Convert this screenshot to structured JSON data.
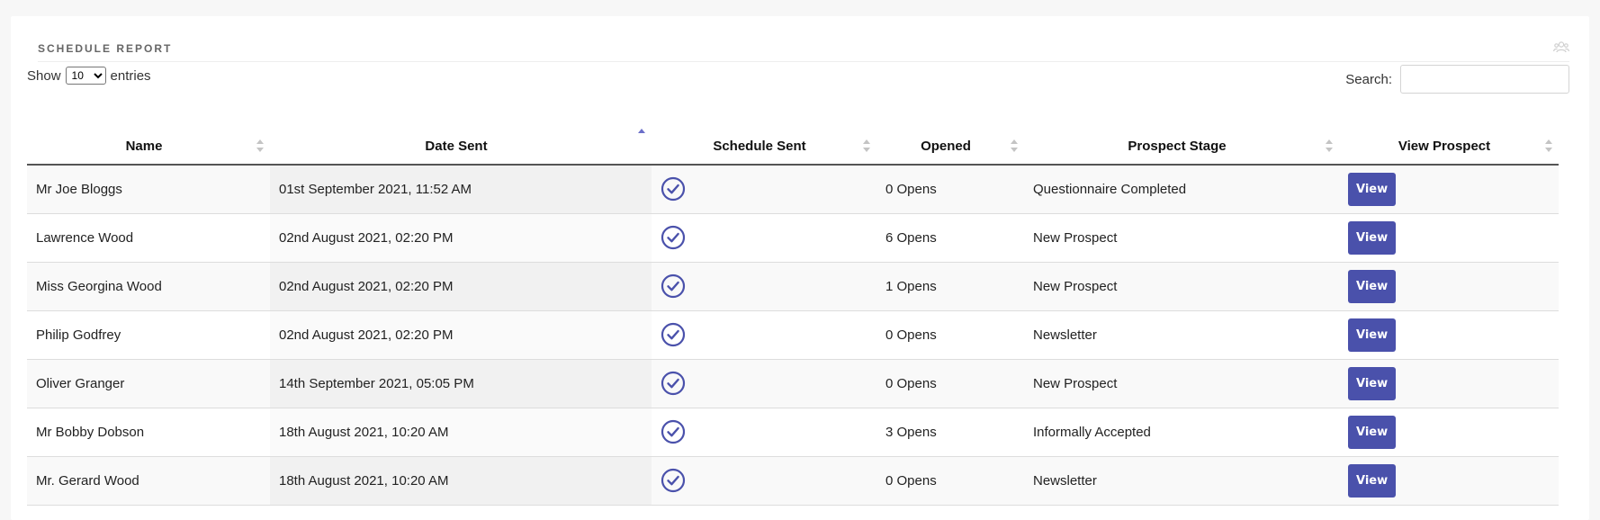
{
  "panel": {
    "title": "SCHEDULE REPORT",
    "header_icon": "users-icon"
  },
  "controls": {
    "show_label": "Show",
    "entries_label": "entries",
    "page_length": "10",
    "search_label": "Search:",
    "search_value": ""
  },
  "table": {
    "columns": [
      {
        "label": "Name",
        "sort": "none"
      },
      {
        "label": "Date Sent",
        "sort": "asc"
      },
      {
        "label": "Schedule Sent",
        "sort": "none"
      },
      {
        "label": "Opened",
        "sort": "none"
      },
      {
        "label": "Prospect Stage",
        "sort": "none"
      },
      {
        "label": "View Prospect",
        "sort": "none"
      }
    ],
    "rows": [
      {
        "name": "Mr Joe Bloggs",
        "date": "01st September 2021, 11:52 AM",
        "sent": true,
        "opened": "0 Opens",
        "stage": "Questionnaire Completed",
        "action": "View"
      },
      {
        "name": "Lawrence Wood",
        "date": "02nd August 2021, 02:20 PM",
        "sent": true,
        "opened": "6 Opens",
        "stage": "New Prospect",
        "action": "View"
      },
      {
        "name": "Miss Georgina Wood",
        "date": "02nd August 2021, 02:20 PM",
        "sent": true,
        "opened": "1 Opens",
        "stage": "New Prospect",
        "action": "View"
      },
      {
        "name": "Philip Godfrey",
        "date": "02nd August 2021, 02:20 PM",
        "sent": true,
        "opened": "0 Opens",
        "stage": "Newsletter",
        "action": "View"
      },
      {
        "name": "Oliver Granger",
        "date": "14th September 2021, 05:05 PM",
        "sent": true,
        "opened": "0 Opens",
        "stage": "New Prospect",
        "action": "View"
      },
      {
        "name": "Mr Bobby Dobson",
        "date": "18th August 2021, 10:20 AM",
        "sent": true,
        "opened": "3 Opens",
        "stage": "Informally Accepted",
        "action": "View"
      },
      {
        "name": "Mr. Gerard Wood",
        "date": "18th August 2021, 10:20 AM",
        "sent": true,
        "opened": "0 Opens",
        "stage": "Newsletter",
        "action": "View"
      }
    ]
  },
  "colors": {
    "accent": "#4a51ab",
    "check": "#4a51ab",
    "sort_active": "#6b6fc9",
    "sort_inactive": "#c4c4c4"
  }
}
